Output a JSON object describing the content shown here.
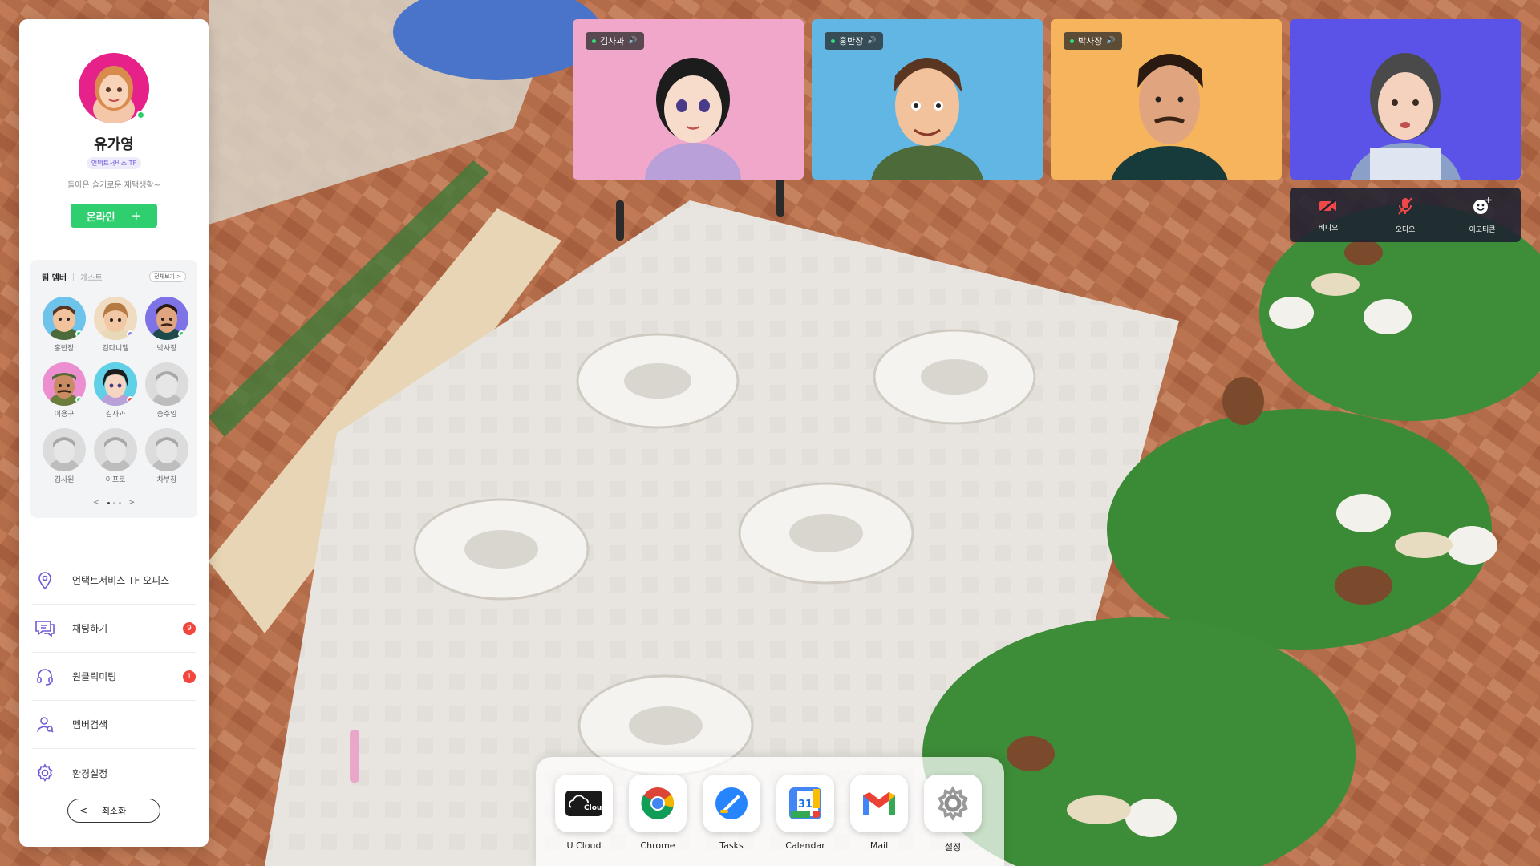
{
  "profile": {
    "name": "유가영",
    "team_badge": "언택트서비스 TF",
    "status_message": "돌아온 슬기로운 재택생활~",
    "online_button": "온라인",
    "online_plus": "+"
  },
  "team": {
    "tab_members": "팀 멤버",
    "tab_guest": "게스트",
    "view_all": "전체보기 >",
    "members": [
      {
        "name": "홍반장",
        "status": "online"
      },
      {
        "name": "김다니엘",
        "status": "away"
      },
      {
        "name": "박사장",
        "status": "online"
      },
      {
        "name": "이용구",
        "status": "online"
      },
      {
        "name": "김사과",
        "status": "busy"
      },
      {
        "name": "송주임",
        "status": "offline"
      },
      {
        "name": "김사원",
        "status": "offline"
      },
      {
        "name": "이프로",
        "status": "offline"
      },
      {
        "name": "차부장",
        "status": "offline"
      }
    ],
    "pager_prev": "<",
    "pager_next": ">"
  },
  "menu": [
    {
      "label": "언택트서비스 TF 오피스",
      "icon": "location-pin-icon",
      "badge": ""
    },
    {
      "label": "채팅하기",
      "icon": "chat-icon",
      "badge": "9"
    },
    {
      "label": "원클릭미팅",
      "icon": "headset-icon",
      "badge": "1"
    },
    {
      "label": "멤버검색",
      "icon": "member-search-icon",
      "badge": ""
    },
    {
      "label": "환경설정",
      "icon": "gear-icon",
      "badge": ""
    }
  ],
  "minimize": {
    "label": "최소화",
    "chevron": "<"
  },
  "video_tiles": [
    {
      "name": "김사과",
      "bg": "#f0a7c9",
      "speaker": "🔊"
    },
    {
      "name": "홍반장",
      "bg": "#62b6e4",
      "speaker": "🔊"
    },
    {
      "name": "박사장",
      "bg": "#f6b55c",
      "speaker": "🔊"
    },
    {
      "name": "",
      "bg": "#5b52e8",
      "speaker": ""
    }
  ],
  "controls": [
    {
      "label": "비디오",
      "icon": "video-off-icon"
    },
    {
      "label": "오디오",
      "icon": "mic-off-icon"
    },
    {
      "label": "이모티콘",
      "icon": "emoji-add-icon"
    }
  ],
  "dock": [
    {
      "label": "U Cloud",
      "icon": "ucloud-icon",
      "text": "Cloud"
    },
    {
      "label": "Chrome",
      "icon": "chrome-icon",
      "text": ""
    },
    {
      "label": "Tasks",
      "icon": "tasks-icon",
      "text": ""
    },
    {
      "label": "Calendar",
      "icon": "calendar-icon",
      "text": "31"
    },
    {
      "label": "Mail",
      "icon": "mail-icon",
      "text": ""
    },
    {
      "label": "설정",
      "icon": "settings-icon",
      "text": ""
    }
  ],
  "colors": {
    "online": "#2fcf6f",
    "badge": "#f2453d",
    "accent": "#6b5bd6",
    "floor_wood": "#b06a47",
    "carpet": "#e9e6e1",
    "grass": "#3f8f3a"
  }
}
